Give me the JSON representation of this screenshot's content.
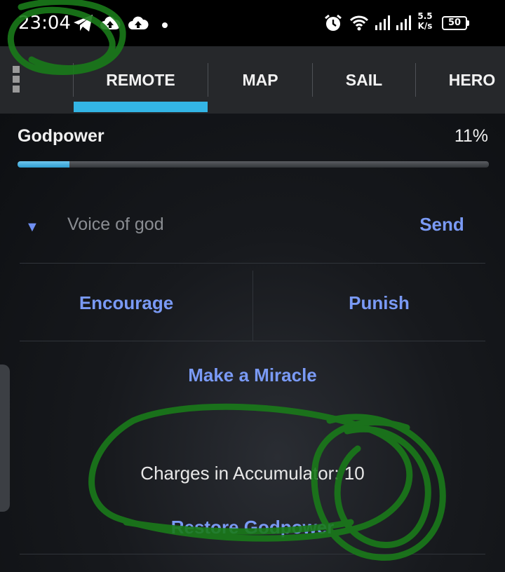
{
  "status_bar": {
    "time": "23:04",
    "net_speed_value": "5.5",
    "net_speed_unit": "K/s",
    "battery_level": "50"
  },
  "tabs": [
    {
      "label": "REMOTE",
      "active": true
    },
    {
      "label": "MAP",
      "active": false
    },
    {
      "label": "SAIL",
      "active": false
    },
    {
      "label": "HERO",
      "active": false
    }
  ],
  "godpower": {
    "label": "Godpower",
    "value_text": "11%",
    "fraction": 0.11
  },
  "voice": {
    "placeholder": "Voice of god",
    "value": "",
    "send_label": "Send"
  },
  "actions": {
    "encourage_label": "Encourage",
    "punish_label": "Punish",
    "miracle_label": "Make a Miracle"
  },
  "accumulator": {
    "charges_text": "Charges in Accumulator: 10",
    "restore_label": "Restore Godpower"
  },
  "colors": {
    "accent": "#33b5e5",
    "link": "#7a9af5",
    "annotation": "#1a7a1a"
  }
}
